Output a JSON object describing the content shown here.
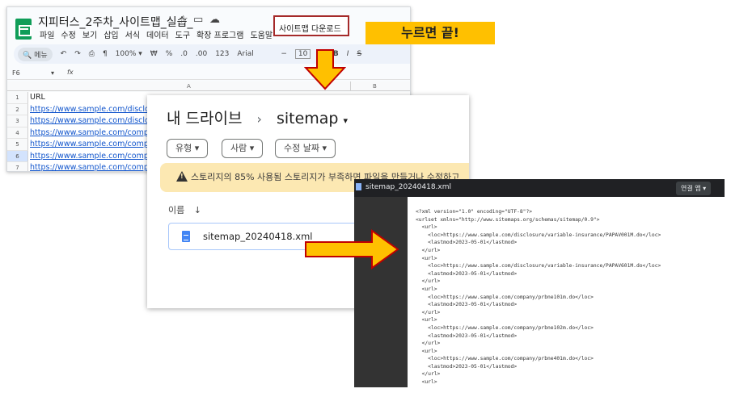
{
  "sheets": {
    "title": "지피터스_2주차_사이트맵_실습_",
    "menu": [
      "파일",
      "수정",
      "보기",
      "삽입",
      "서식",
      "데이터",
      "도구",
      "확장 프로그램",
      "도움말"
    ],
    "sitemap_download": "사이트맵 다운로드",
    "toolbar": {
      "menu_search": "메뉴",
      "zoom": "100%",
      "currency": "₩",
      "percent": "%",
      "dec_less": ".0",
      "dec_more": ".00",
      "format_123": "123",
      "font": "Arial",
      "font_size": "10",
      "bold": "B",
      "italic": "I",
      "strike": "S"
    },
    "cell_ref": "F6",
    "fx": "fx",
    "col_a": "A",
    "col_b": "B",
    "rows": [
      {
        "n": "1",
        "text": "URL"
      },
      {
        "n": "2",
        "text": "https://www.sample.com/disclosure/"
      },
      {
        "n": "3",
        "text": "https://www.sample.com/disclosure/"
      },
      {
        "n": "4",
        "text": "https://www.sample.com/company/p"
      },
      {
        "n": "5",
        "text": "https://www.sample.com/company/p"
      },
      {
        "n": "6",
        "text": "https://www.sample.com/company/p"
      },
      {
        "n": "7",
        "text": "https://www.sample.com/company/p"
      }
    ]
  },
  "callout": "누르면 끝!",
  "drive": {
    "root": "내 드라이브",
    "separator": "›",
    "folder": "sitemap",
    "filters": [
      "유형",
      "사람",
      "수정 날짜"
    ],
    "storage_warning": "스토리지의 85% 사용됨 스토리지가 부족하면 파일을 만들거나 수정하고",
    "sort_label": "이름",
    "file_name": "sitemap_20240418.xml"
  },
  "xml_viewer": {
    "file_title": "sitemap_20240418.xml",
    "open_with": "연결 앱",
    "content": "<?xml version=\"1.0\" encoding=\"UTF-8\"?>\n<urlset xmlns=\"http://www.sitemaps.org/schemas/sitemap/0.9\">\n  <url>\n    <loc>https://www.sample.com/disclosure/variable-insurance/PAPAV001M.do</loc>\n    <lastmod>2023-05-01</lastmod>\n  </url>\n  <url>\n    <loc>https://www.sample.com/disclosure/variable-insurance/PAPAV601M.do</loc>\n    <lastmod>2023-05-01</lastmod>\n  </url>\n  <url>\n    <loc>https://www.sample.com/company/prbne101m.do</loc>\n    <lastmod>2023-05-01</lastmod>\n  </url>\n  <url>\n    <loc>https://www.sample.com/company/prbne102m.do</loc>\n    <lastmod>2023-05-01</lastmod>\n  </url>\n  <url>\n    <loc>https://www.sample.com/company/prbne401m.do</loc>\n    <lastmod>2023-05-01</lastmod>\n  </url>\n  <url>"
  },
  "colors": {
    "arrow_fill": "#ffc000",
    "arrow_stroke": "#c00000",
    "callout_bg": "#ffc000",
    "highlight_border": "#a52a2a"
  }
}
